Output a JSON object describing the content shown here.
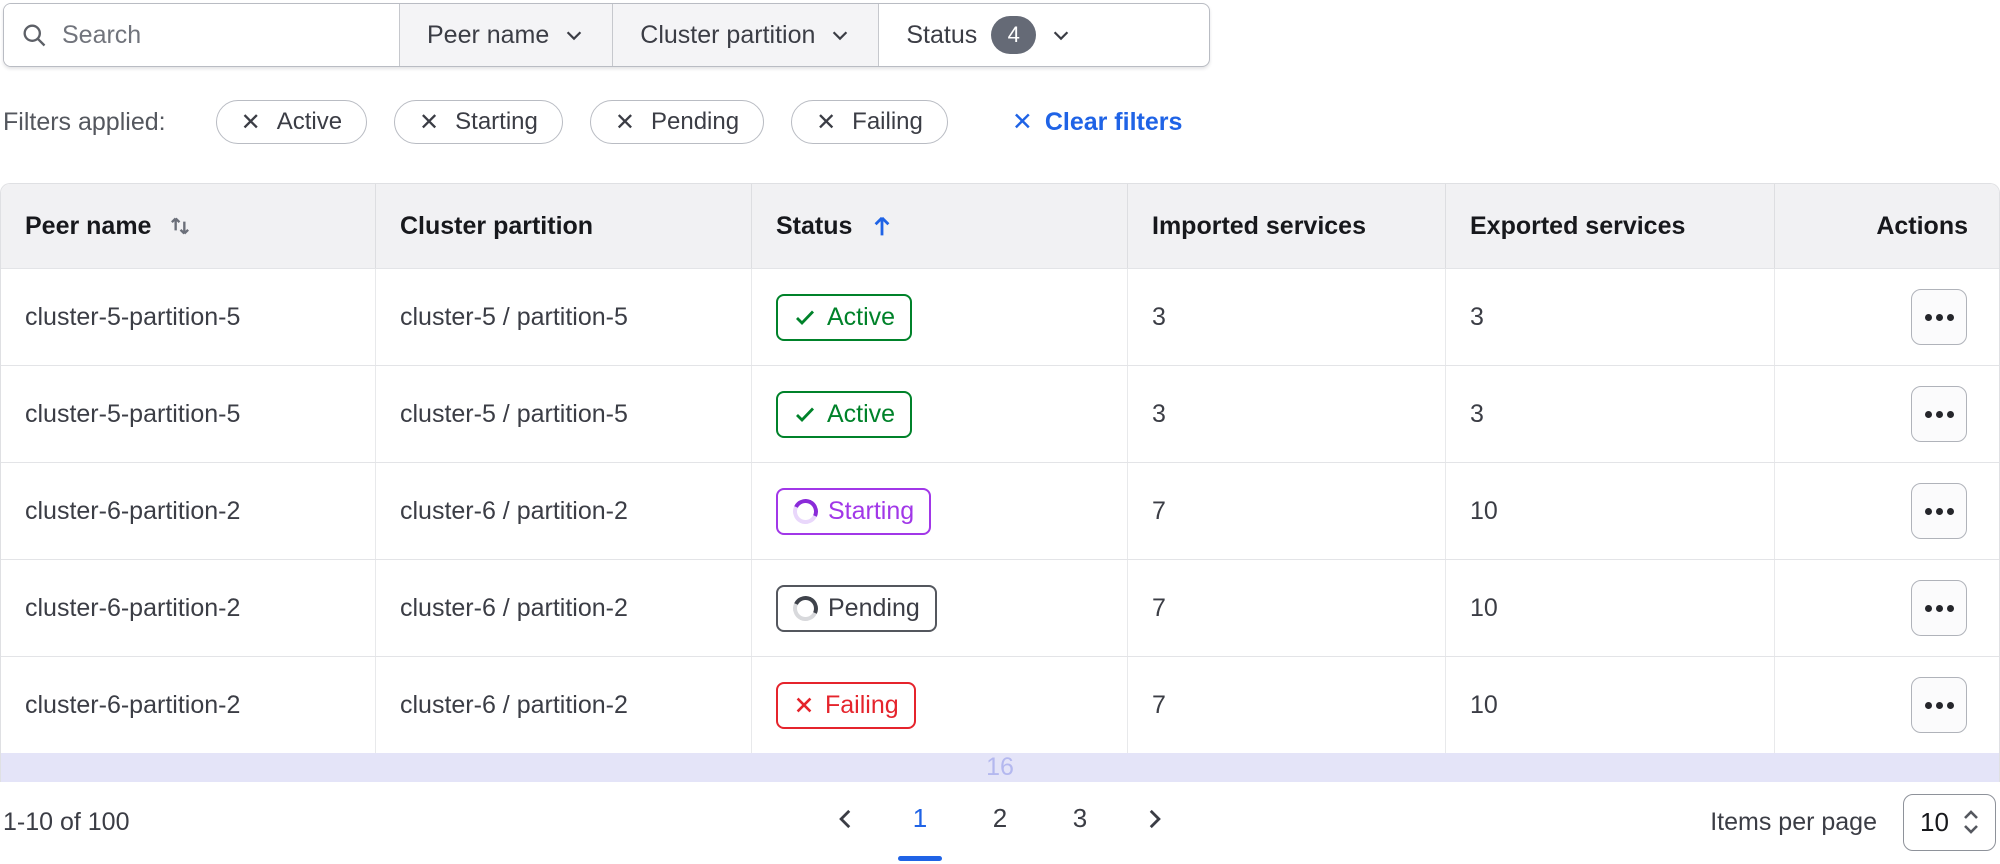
{
  "toolbar": {
    "search": {
      "placeholder": "Search"
    },
    "dropdowns": [
      {
        "label": "Peer name"
      },
      {
        "label": "Cluster partition"
      },
      {
        "label": "Status",
        "count": "4"
      }
    ]
  },
  "filters": {
    "label": "Filters applied:",
    "tags": [
      "Active",
      "Starting",
      "Pending",
      "Failing"
    ],
    "clear_label": "Clear filters"
  },
  "table": {
    "columns": [
      {
        "label": "Peer name",
        "sort_icon": "sort-both"
      },
      {
        "label": "Cluster partition"
      },
      {
        "label": "Status",
        "sort_icon": "sort-ascending"
      },
      {
        "label": "Imported services"
      },
      {
        "label": "Exported services"
      },
      {
        "label": "Actions"
      }
    ],
    "rows": [
      {
        "peer": "cluster-5-partition-5",
        "partition": "cluster-5 / partition-5",
        "status": "Active",
        "variant": "active",
        "imported": "3",
        "exported": "3"
      },
      {
        "peer": "cluster-5-partition-5",
        "partition": "cluster-5 / partition-5",
        "status": "Active",
        "variant": "active",
        "imported": "3",
        "exported": "3"
      },
      {
        "peer": "cluster-6-partition-2",
        "partition": "cluster-6 / partition-2",
        "status": "Starting",
        "variant": "starting",
        "imported": "7",
        "exported": "10"
      },
      {
        "peer": "cluster-6-partition-2",
        "partition": "cluster-6 / partition-2",
        "status": "Pending",
        "variant": "pending",
        "imported": "7",
        "exported": "10"
      },
      {
        "peer": "cluster-6-partition-2",
        "partition": "cluster-6 / partition-2",
        "status": "Failing",
        "variant": "failing",
        "imported": "7",
        "exported": "10"
      }
    ],
    "partial_row_text": "16"
  },
  "pagination": {
    "summary": "1-10 of 100",
    "pages": [
      "1",
      "2",
      "3"
    ],
    "current_page": "1",
    "items_per_page_label": "Items per page",
    "items_per_page_value": "10"
  },
  "colors": {
    "accent_blue": "#1f63e6",
    "status_active": "#00822a",
    "status_starting": "#a137e8",
    "status_pending": "#3b3d45",
    "status_failing": "#e5242c"
  }
}
